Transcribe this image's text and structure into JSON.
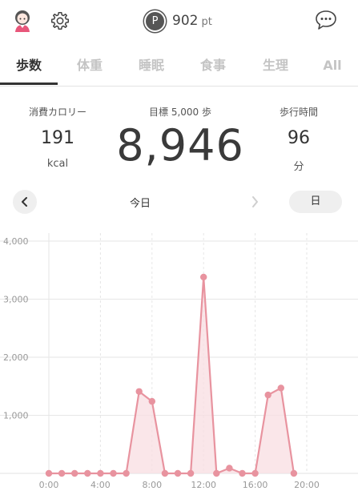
{
  "header": {
    "avatar_icon": "user-avatar-icon",
    "settings_icon": "gear-icon",
    "points_icon_letter": "P",
    "points_value": "902",
    "points_unit": "pt",
    "chat_icon": "chat-bubble-icon"
  },
  "tabs": [
    {
      "label": "歩数",
      "active": true
    },
    {
      "label": "体重",
      "active": false
    },
    {
      "label": "睡眠",
      "active": false
    },
    {
      "label": "食事",
      "active": false
    },
    {
      "label": "生理",
      "active": false
    },
    {
      "label": "All",
      "active": false
    }
  ],
  "summary": {
    "calories_label": "消費カロリー",
    "calories_value": "191",
    "calories_unit": "kcal",
    "goal_label": "目標 5,000 歩",
    "steps_value": "8,946",
    "walk_time_label": "歩行時間",
    "walk_time_value": "96",
    "walk_time_unit": "分"
  },
  "date_nav": {
    "prev_icon": "chevron-left-icon",
    "date_label": "今日",
    "next_icon": "chevron-right-icon",
    "period_label": "日"
  },
  "colors": {
    "accent": "#e8939f",
    "fill": "#f8dde2",
    "grid": "#e6e6e6"
  },
  "chart_data": {
    "type": "area",
    "x": [
      0,
      1,
      2,
      3,
      4,
      5,
      6,
      7,
      8,
      9,
      10,
      11,
      12,
      13,
      14,
      15,
      16,
      17,
      18,
      19
    ],
    "values": [
      0,
      0,
      0,
      0,
      0,
      0,
      0,
      1410,
      1240,
      0,
      0,
      0,
      3380,
      0,
      90,
      0,
      0,
      1350,
      1470,
      0
    ],
    "x_tick_labels": [
      "0:00",
      "4:00",
      "8:00",
      "12:00",
      "16:00",
      "20:00"
    ],
    "x_tick_positions": [
      0,
      4,
      8,
      12,
      16,
      20
    ],
    "y_tick_labels": [
      "4,000",
      "3,000",
      "2,000",
      "1,000"
    ],
    "y_tick_values": [
      4000,
      3000,
      2000,
      1000
    ],
    "ylim": [
      0,
      4000
    ],
    "xlim": [
      0,
      23
    ]
  }
}
